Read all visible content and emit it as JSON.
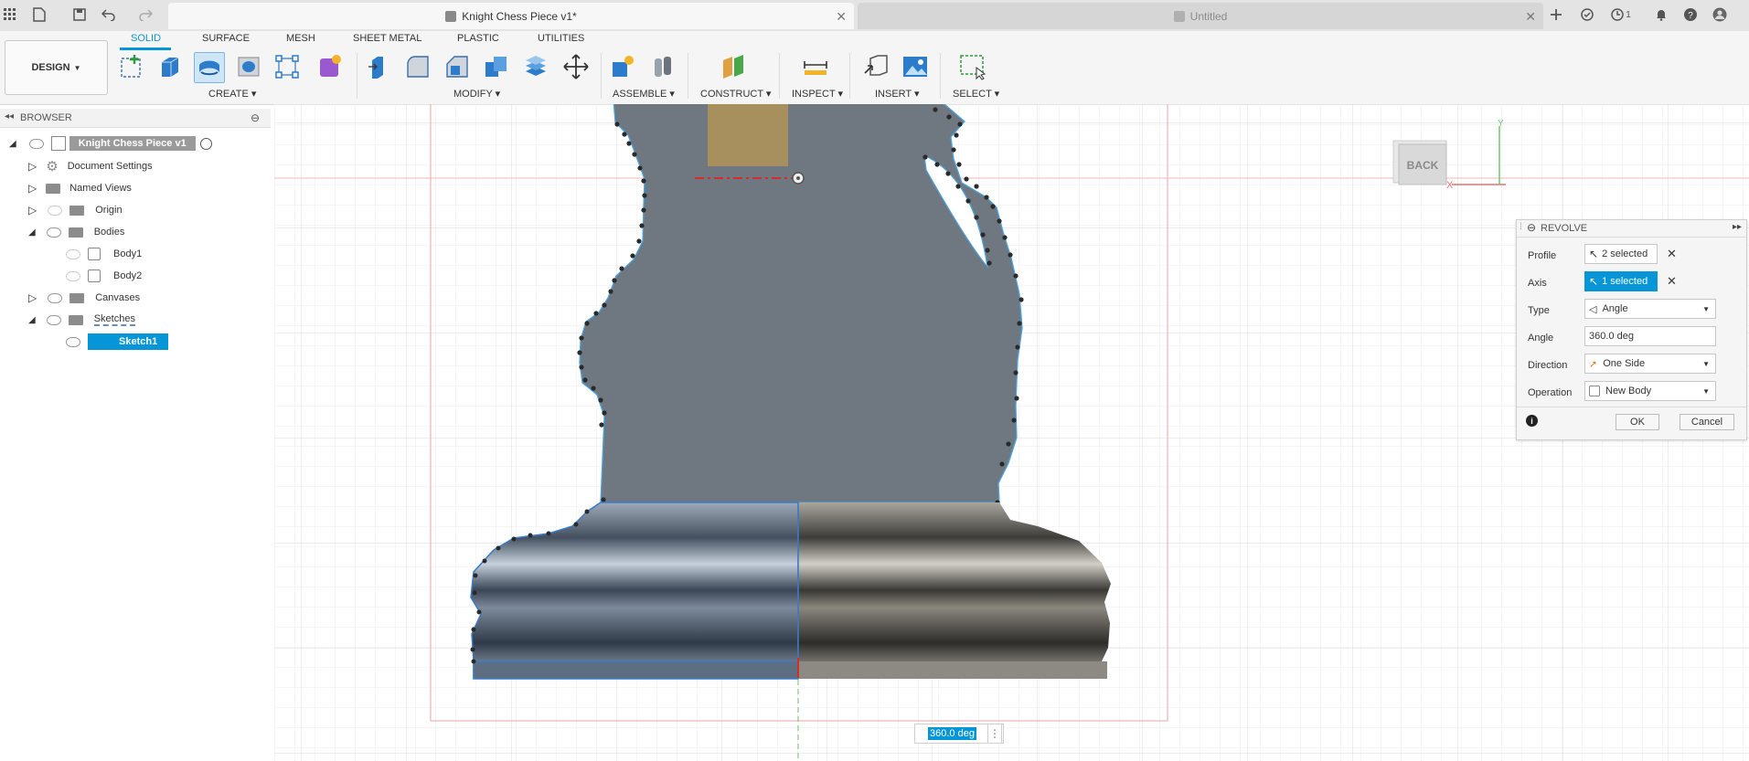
{
  "app": {
    "active_doc_title": "Knight Chess Piece v1*",
    "inactive_doc_title": "Untitled",
    "notifications_count": "1"
  },
  "workspace": {
    "label": "DESIGN"
  },
  "ribbon": {
    "tabs": [
      "SOLID",
      "SURFACE",
      "MESH",
      "SHEET METAL",
      "PLASTIC",
      "UTILITIES"
    ],
    "groups": [
      "CREATE",
      "MODIFY",
      "ASSEMBLE",
      "CONSTRUCT",
      "INSPECT",
      "INSERT",
      "SELECT"
    ]
  },
  "browser": {
    "title": "BROWSER",
    "root": "Knight Chess Piece v1",
    "items": [
      "Document Settings",
      "Named Views",
      "Origin",
      "Bodies",
      "Body1",
      "Body2",
      "Canvases",
      "Sketches",
      "Sketch1"
    ]
  },
  "viewcube": {
    "face": "BACK",
    "axis_x": "X",
    "axis_y": "Y"
  },
  "revolve": {
    "title": "REVOLVE",
    "profile_label": "Profile",
    "profile_value": "2 selected",
    "axis_label": "Axis",
    "axis_value": "1 selected",
    "type_label": "Type",
    "type_value": "Angle",
    "angle_label": "Angle",
    "angle_value": "360.0 deg",
    "direction_label": "Direction",
    "direction_value": "One Side",
    "operation_label": "Operation",
    "operation_value": "New Body",
    "ok_label": "OK",
    "cancel_label": "Cancel"
  },
  "dimension_input": {
    "value": "360.0 deg"
  },
  "colors": {
    "accent": "#0696d7",
    "sketch_profile": "#6f7880",
    "highlight": "#0696d7"
  }
}
